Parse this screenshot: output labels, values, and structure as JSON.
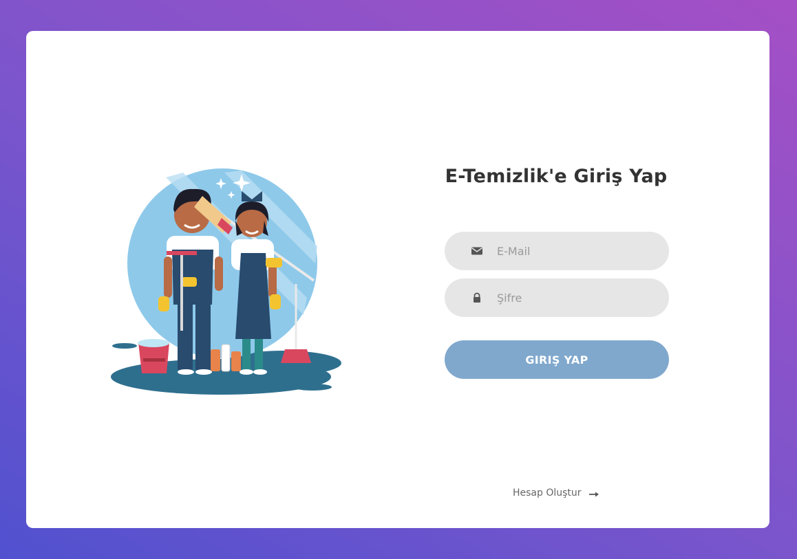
{
  "login": {
    "title": "E-Temizlik'e Giriş Yap",
    "email_placeholder": "E-Mail",
    "password_placeholder": "Şifre",
    "submit_label": "GIRIŞ YAP",
    "register_link": "Hesap Oluştur"
  },
  "icons": {
    "email": "envelope-icon",
    "password": "lock-icon",
    "register": "arrow-right-icon"
  },
  "colors": {
    "background_start": "#5151cf",
    "background_end": "#a54fc5",
    "card": "#ffffff",
    "input_background": "#e6e6e6",
    "button": "#80a8cd",
    "title": "#333333"
  }
}
